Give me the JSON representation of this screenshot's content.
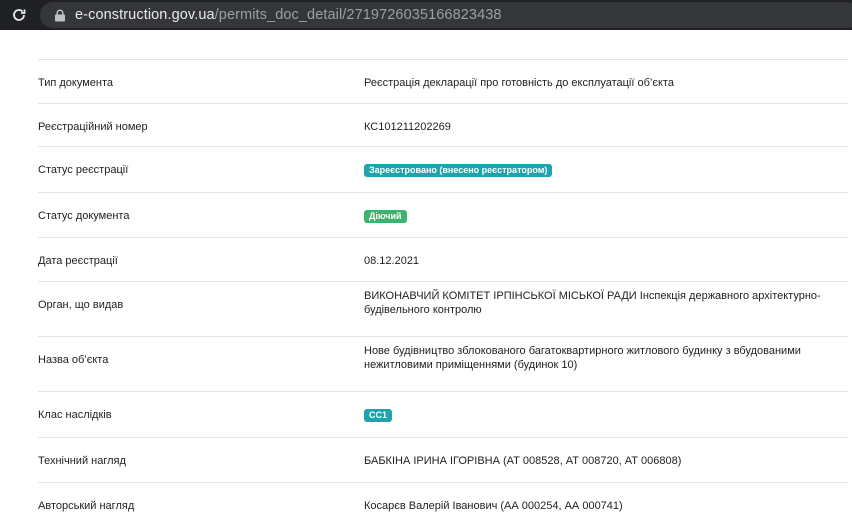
{
  "browser": {
    "url_host": "e-construction.gov.ua",
    "url_path": "/permits_doc_detail/2719726035166823438"
  },
  "details": [
    {
      "label": "Тип документа",
      "value": "Реєстрація декларації про готовність до експлуатації об’єкта"
    },
    {
      "label": "Реєстраційний номер",
      "value": "КС101211202269"
    },
    {
      "label": "Статус реєстрації",
      "badge": "Зареєстровано (внесено реєстратором)",
      "badge_color": "#1fa3ad"
    },
    {
      "label": "Статус документа",
      "badge": "Діючий",
      "badge_color": "#3cb46d"
    },
    {
      "label": "Дата реєстрації",
      "value": "08.12.2021"
    },
    {
      "label": "Орган, що видав",
      "value": "ВИКОНАВЧИЙ КОМІТЕТ ІРПІНСЬКОЇ МІСЬКОЇ РАДИ Інспекція державного архітектурно-будівельного контролю"
    },
    {
      "label": "Назва об’єкта",
      "value": "Нове будівництво зблокованого багатоквартирного житлового будинку з вбудованими нежитловими приміщеннями (будинок 10)"
    },
    {
      "label": "Клас наслідків",
      "badge": "СС1",
      "badge_color": "#1fa3ad"
    },
    {
      "label": "Технічний нагляд",
      "value": "БАБКІНА ІРИНА ІГОРІВНА (АТ 008528, АТ 008720, АТ 006808)"
    },
    {
      "label": "Авторський нагляд",
      "value": "Косарєв Валерій Іванович (АА 000254, АА 000741)"
    }
  ]
}
